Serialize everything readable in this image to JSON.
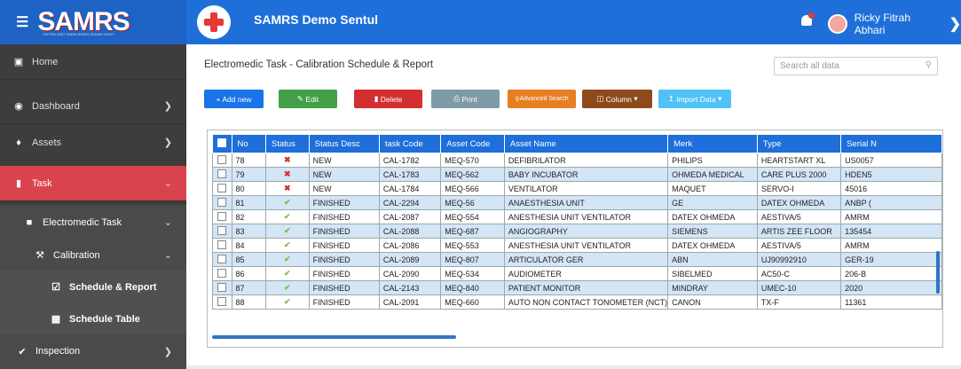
{
  "topbar": {
    "brand": "SAMRS",
    "brand_sub": "SISTEM ASET MANAJEMEN RUMAH SAKIT",
    "app_title": "SAMRS Demo Sentul",
    "user_name": "Ricky Fitrah Abhari"
  },
  "sidebar": {
    "items": [
      {
        "label": "Home",
        "icon": "laptop-icon"
      },
      {
        "label": "Dashboard",
        "icon": "dashboard-icon"
      },
      {
        "label": "Assets",
        "icon": "assets-icon"
      },
      {
        "label": "Task",
        "icon": "task-icon"
      },
      {
        "label": "Electromedic Task",
        "icon": "file-icon"
      },
      {
        "label": "Calibration",
        "icon": "calibration-icon"
      },
      {
        "label": "Schedule & Report",
        "icon": "calendar-check-icon"
      },
      {
        "label": "Schedule Table",
        "icon": "calendar-icon"
      },
      {
        "label": "Inspection",
        "icon": "check-icon"
      }
    ]
  },
  "main": {
    "title": "Electromedic Task - Calibration Schedule & Report",
    "search_placeholder": "Search all data",
    "toolbar": {
      "add": "+ Add new",
      "edit": "Edit",
      "delete": "Delete",
      "print": "Print",
      "advanced_search": "Advanced Search",
      "column": "Column",
      "import": "Import Data"
    },
    "colors": {
      "add": "#1a73e8",
      "edit": "#43a047",
      "delete": "#d32f2f",
      "print": "#7f9aa7",
      "advanced_search": "#e67e22",
      "column": "#8d4a1b",
      "import": "#4fc3f7"
    },
    "table": {
      "headers": [
        "No",
        "Status",
        "Status Desc",
        "task Code",
        "Asset Code",
        "Asset Name",
        "Merk",
        "Type",
        "Serial N"
      ],
      "rows": [
        [
          "78",
          "x",
          "NEW",
          "CAL-1782",
          "MEQ-570",
          "DEFIBRILATOR",
          "PHILIPS",
          "HEARTSTART XL",
          "US0057"
        ],
        [
          "79",
          "x",
          "NEW",
          "CAL-1783",
          "MEQ-562",
          "BABY INCUBATOR",
          "OHMEDA MEDICAL",
          "CARE PLUS 2000",
          "HDEN5"
        ],
        [
          "80",
          "x",
          "NEW",
          "CAL-1784",
          "MEQ-566",
          "VENTILATOR",
          "MAQUET",
          "SERVO-I",
          "45016"
        ],
        [
          "81",
          "ok",
          "FINISHED",
          "CAL-2294",
          "MEQ-56",
          "ANAESTHESIA UNIT",
          "GE",
          "DATEX OHMEDA",
          "ANBP ("
        ],
        [
          "82",
          "ok",
          "FINISHED",
          "CAL-2087",
          "MEQ-554",
          "ANESTHESIA UNIT VENTILATOR",
          "DATEX OHMEDA",
          "AESTIVA/5",
          "AMRM"
        ],
        [
          "83",
          "ok",
          "FINISHED",
          "CAL-2088",
          "MEQ-687",
          "ANGIOGRAPHY",
          "SIEMENS",
          "ARTIS ZEE FLOOR",
          "135454"
        ],
        [
          "84",
          "ok",
          "FINISHED",
          "CAL-2086",
          "MEQ-553",
          "ANESTHESIA UNIT VENTILATOR",
          "DATEX OHMEDA",
          "AESTIVA/5",
          "AMRM"
        ],
        [
          "85",
          "ok",
          "FINISHED",
          "CAL-2089",
          "MEQ-807",
          "ARTICULATOR GER",
          "ABN",
          "UJ90992910",
          "GER-19"
        ],
        [
          "86",
          "ok",
          "FINISHED",
          "CAL-2090",
          "MEQ-534",
          "AUDIOMETER",
          "SIBELMED",
          "AC50-C",
          "206-B"
        ],
        [
          "87",
          "ok",
          "FINISHED",
          "CAL-2143",
          "MEQ-840",
          "PATIENT MONITOR",
          "MINDRAY",
          "UMEC-10",
          "2020"
        ],
        [
          "88",
          "ok",
          "FINISHED",
          "CAL-2091",
          "MEQ-660",
          "AUTO NON CONTACT TONOMETER (NCT)",
          "CANON",
          "TX-F",
          "11361"
        ]
      ]
    }
  }
}
